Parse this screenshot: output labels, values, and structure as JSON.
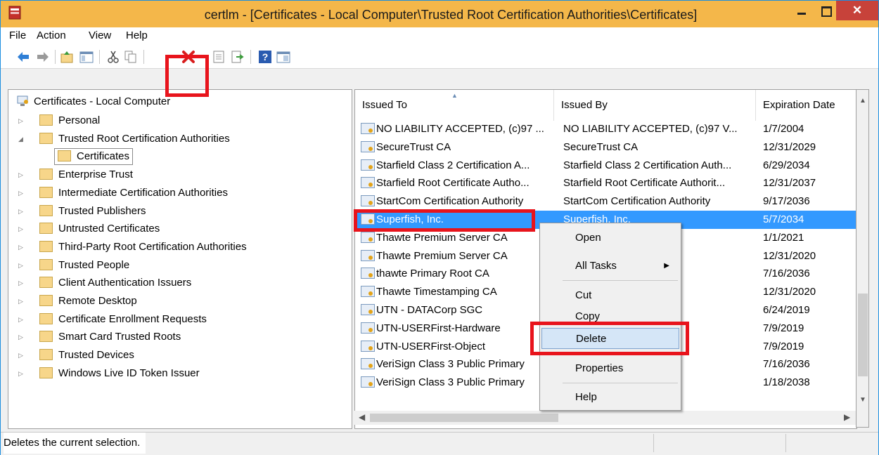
{
  "window": {
    "title": "certlm - [Certificates - Local Computer\\Trusted Root Certification Authorities\\Certificates]"
  },
  "menu": [
    "File",
    "Action",
    "View",
    "Help"
  ],
  "toolbar_icons": [
    "back-icon",
    "forward-icon",
    "up-folder-icon",
    "show-hide-tree-icon",
    "cut-icon",
    "copy-icon",
    "delete-icon",
    "properties-icon",
    "export-icon",
    "help-icon",
    "console-icon"
  ],
  "tree": {
    "root": "Certificates - Local Computer",
    "items": [
      {
        "label": "Personal"
      },
      {
        "label": "Trusted Root Certification Authorities"
      },
      {
        "label": "Certificates"
      },
      {
        "label": "Enterprise Trust"
      },
      {
        "label": "Intermediate Certification Authorities"
      },
      {
        "label": "Trusted Publishers"
      },
      {
        "label": "Untrusted Certificates"
      },
      {
        "label": "Third-Party Root Certification Authorities"
      },
      {
        "label": "Trusted People"
      },
      {
        "label": "Client Authentication Issuers"
      },
      {
        "label": "Remote Desktop"
      },
      {
        "label": "Certificate Enrollment Requests"
      },
      {
        "label": "Smart Card Trusted Roots"
      },
      {
        "label": "Trusted Devices"
      },
      {
        "label": "Windows Live ID Token Issuer"
      }
    ]
  },
  "columns": [
    "Issued To",
    "Issued By",
    "Expiration Date"
  ],
  "rows": [
    {
      "to": "NO LIABILITY ACCEPTED, (c)97 ...",
      "by": "NO LIABILITY ACCEPTED, (c)97 V...",
      "exp": "1/7/2004"
    },
    {
      "to": "SecureTrust CA",
      "by": "SecureTrust CA",
      "exp": "12/31/2029"
    },
    {
      "to": "Starfield Class 2 Certification A...",
      "by": "Starfield Class 2 Certification Auth...",
      "exp": "6/29/2034"
    },
    {
      "to": "Starfield Root Certificate Autho...",
      "by": "Starfield Root Certificate Authorit...",
      "exp": "12/31/2037"
    },
    {
      "to": "StartCom Certification Authority",
      "by": "StartCom Certification Authority",
      "exp": "9/17/2036"
    },
    {
      "to": "Superfish, Inc.",
      "by": "Superfish, Inc.",
      "exp": "5/7/2034"
    },
    {
      "to": "Thawte Premium Server CA",
      "by": "er CA",
      "exp": "1/1/2021"
    },
    {
      "to": "Thawte Premium Server CA",
      "by": "er CA",
      "exp": "12/31/2020"
    },
    {
      "to": "thawte Primary Root CA",
      "by": "A",
      "exp": "7/16/2036"
    },
    {
      "to": "Thawte Timestamping CA",
      "by": "CA",
      "exp": "12/31/2020"
    },
    {
      "to": "UTN - DATACorp SGC",
      "by": "",
      "exp": "6/24/2019"
    },
    {
      "to": "UTN-USERFirst-Hardware",
      "by": "re",
      "exp": "7/9/2019"
    },
    {
      "to": "UTN-USERFirst-Object",
      "by": "",
      "exp": "7/9/2019"
    },
    {
      "to": "VeriSign Class 3 Public Primary",
      "by": "Primary Ce...",
      "exp": "7/16/2036"
    },
    {
      "to": "VeriSign Class 3 Public Primary",
      "by": "Primary Ce...",
      "exp": "1/18/2038"
    }
  ],
  "context_menu": {
    "items": [
      "Open",
      "All Tasks",
      "Cut",
      "Copy",
      "Delete",
      "Properties",
      "Help"
    ]
  },
  "status": {
    "text": "Deletes the current selection."
  },
  "colors": {
    "titlebar": "#f4b74a",
    "close": "#c7423a",
    "selection": "#3399ff",
    "highlight_box": "#e8141c"
  }
}
